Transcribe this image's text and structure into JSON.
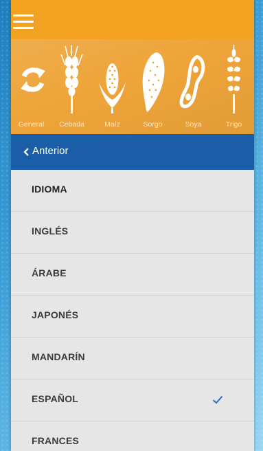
{
  "topbar": {
    "menu_icon": "hamburger-icon",
    "color": "#f2a121"
  },
  "crops": [
    {
      "label": "General",
      "icon": "refresh-icon"
    },
    {
      "label": "Cebada",
      "icon": "barley-icon"
    },
    {
      "label": "Maíz",
      "icon": "corn-icon"
    },
    {
      "label": "Sorgo",
      "icon": "sorghum-icon"
    },
    {
      "label": "Soya",
      "icon": "soybean-icon"
    },
    {
      "label": "Trigo",
      "icon": "wheat-icon"
    }
  ],
  "back": {
    "label": "Anterior",
    "icon": "chevron-left-icon",
    "color": "#1b5ea8"
  },
  "list": {
    "heading": "IDIOMA",
    "items": [
      {
        "label": "INGLÉS",
        "selected": false
      },
      {
        "label": "ÁRABE",
        "selected": false
      },
      {
        "label": "JAPONÉS",
        "selected": false
      },
      {
        "label": "MANDARÍN",
        "selected": false
      },
      {
        "label": "ESPAÑOL",
        "selected": true,
        "check_icon": "checkmark-icon"
      },
      {
        "label": "FRANCES",
        "selected": false
      }
    ]
  }
}
